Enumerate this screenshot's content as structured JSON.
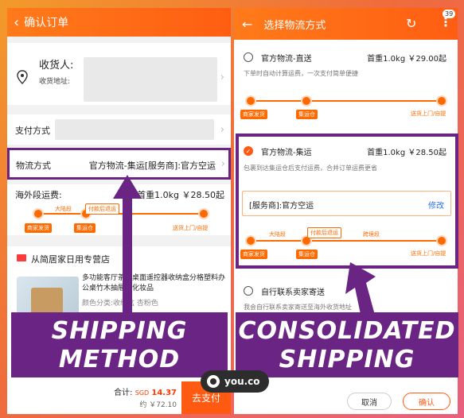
{
  "left": {
    "header": {
      "title": "确认订单"
    },
    "address": {
      "recipient_label": "收货人:",
      "address_label": "收货地址:"
    },
    "payment": {
      "label": "支付方式"
    },
    "shipping": {
      "label": "物流方式",
      "value": "官方物流-集运[服务商]:官方空运"
    },
    "overseas_fee": {
      "label": "海外段运费:",
      "value": "首重1.0kg ￥28.50起"
    },
    "track": {
      "nodes": [
        "商家发货",
        "集运仓",
        "送货上门/自提"
      ],
      "segment": "大陆段",
      "badge": "付款后退运"
    },
    "store": {
      "name": "从简居家日用专营店",
      "product_title": "多功能客厅茶几桌面遥控器收纳盒分格塑料办公桌竹木抽屉盒化妆品",
      "spec": "颜色分类:收纳盒 杏粉色"
    },
    "bottom": {
      "total_label": "合计:",
      "currency": "SGD",
      "amount": "14.37",
      "approx": "约 ￥72.10",
      "pay_button": "去支付"
    }
  },
  "right": {
    "header": {
      "title": "选择物流方式",
      "badge_count": "39"
    },
    "option1": {
      "name": "官方物流-直送",
      "price": "首重1.0kg ￥29.00起",
      "desc": "下单时自动计算运费，一次支付简单便捷",
      "nodes": [
        "商家发货",
        "集运仓",
        "送货上门/自提"
      ]
    },
    "option2": {
      "name": "官方物流-集运",
      "price": "首重1.0kg ￥28.50起",
      "desc": "包裹到达集运仓后支付运费，合并订单运费更省",
      "forwarder": "[服务商]:官方空运",
      "edit": "修改",
      "nodes": [
        "商家发货",
        "集运仓",
        "送货上门/自提"
      ],
      "segment1": "大陆段",
      "segment2": "跨境段",
      "badge": "付款后退运"
    },
    "option3": {
      "name": "自行联系卖家寄送",
      "desc": "我会自行联系卖家寄送至海外收货地址"
    },
    "bottom": {
      "cancel": "取消",
      "confirm": "确认"
    }
  },
  "overlays": {
    "left_banner": [
      "SHIPPING",
      "METHOD"
    ],
    "right_banner": [
      "CONSOLIDATED",
      "SHIPPING"
    ],
    "watermark": "you.co"
  },
  "colors": {
    "accent": "#ff5a12",
    "highlight": "#6a2483",
    "background": "#f06b3c"
  }
}
